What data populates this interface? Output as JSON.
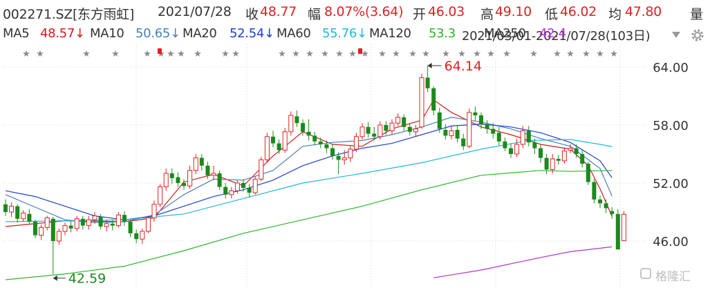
{
  "header": {
    "code": "002271.SZ[东方雨虹]",
    "date": "2021/07/28",
    "close_label": "收",
    "close_value": "48.77",
    "change_label": "幅",
    "change_value": "8.07%(3.64)",
    "open_label": "开",
    "open_value": "46.03",
    "high_label": "高",
    "high_value": "49.10",
    "low_label": "低",
    "low_value": "46.02",
    "avg_label": "均",
    "avg_value": "47.80",
    "vol_label": "量"
  },
  "ma_bar": {
    "ma5_label": "MA5",
    "ma5_value": "48.57↓",
    "ma10_label": "MA10",
    "ma10_value": "50.65↓",
    "ma20_label": "MA20",
    "ma20_value": "52.54↓",
    "ma60_label": "MA60",
    "ma60_value": "55.76↓",
    "ma120_label": "MA120",
    "ma120_value": "53.3",
    "overlap_text": "2021/03/01-2021/07/28(103日)",
    "ma250_label": "MA250",
    "ma250_value": "42.4",
    "dropdown_icon": "triangle-down-icon",
    "settings_icon": "gear-icon"
  },
  "annotations": {
    "max_label": "64.14",
    "min_label": "42.59"
  },
  "watermark": "格隆汇",
  "colors": {
    "up": "#e02020",
    "down": "#1a8a1a",
    "ma5": "#d11b1b",
    "ma10": "#1a3fd0",
    "ma20": "#1a3fd0",
    "ma60": "#22b8e0",
    "ma120": "#2bb52b",
    "ma250": "#b030d0",
    "grid": "#d0d0d0",
    "dark": "#333333"
  },
  "chart_data": {
    "type": "candlestick",
    "title": "002271.SZ[东方雨虹]",
    "period": "2021/03/01-2021/07/28",
    "days": 103,
    "yaxis_ticks": [
      "64.00",
      "58.00",
      "52.00",
      "46.00"
    ],
    "ylim": [
      42,
      67
    ],
    "candles": [
      [
        49.8,
        49.0,
        50.3,
        48.6
      ],
      [
        49.0,
        49.6,
        50.0,
        48.5
      ],
      [
        49.6,
        48.3,
        49.8,
        47.9
      ],
      [
        48.3,
        48.9,
        49.2,
        48.0
      ],
      [
        48.8,
        48.0,
        49.3,
        47.7
      ],
      [
        48.0,
        46.6,
        48.2,
        46.3
      ],
      [
        46.6,
        47.4,
        47.7,
        46.1
      ],
      [
        47.4,
        48.4,
        48.6,
        47.1
      ],
      [
        48.3,
        46.0,
        48.5,
        42.59
      ],
      [
        46.0,
        47.0,
        47.3,
        45.6
      ],
      [
        47.0,
        47.6,
        47.9,
        46.6
      ],
      [
        47.6,
        47.3,
        48.1,
        46.9
      ],
      [
        47.3,
        48.3,
        48.6,
        47.0
      ],
      [
        48.3,
        47.6,
        48.6,
        47.2
      ],
      [
        47.6,
        48.2,
        48.6,
        47.2
      ],
      [
        48.2,
        48.6,
        49.0,
        47.8
      ],
      [
        48.5,
        47.5,
        48.8,
        47.2
      ],
      [
        47.5,
        47.8,
        48.2,
        47.0
      ],
      [
        47.8,
        47.6,
        48.2,
        47.1
      ],
      [
        47.6,
        48.7,
        49.0,
        47.4
      ],
      [
        48.7,
        48.0,
        49.1,
        47.6
      ],
      [
        48.0,
        46.8,
        48.2,
        46.4
      ],
      [
        46.8,
        46.2,
        47.2,
        45.8
      ],
      [
        46.2,
        47.0,
        47.3,
        45.7
      ],
      [
        47.0,
        48.4,
        48.6,
        46.8
      ],
      [
        48.4,
        49.8,
        50.2,
        48.0
      ],
      [
        49.8,
        51.6,
        51.9,
        49.5
      ],
      [
        51.6,
        53.0,
        53.5,
        51.2
      ],
      [
        53.0,
        52.5,
        53.5,
        51.9
      ],
      [
        52.6,
        52.0,
        53.1,
        51.6
      ],
      [
        52.0,
        51.7,
        52.4,
        51.3
      ],
      [
        51.7,
        53.3,
        53.8,
        51.4
      ],
      [
        53.3,
        54.6,
        55.0,
        52.9
      ],
      [
        54.6,
        53.8,
        55.0,
        53.3
      ],
      [
        53.8,
        52.8,
        54.2,
        52.4
      ],
      [
        52.8,
        53.0,
        53.8,
        52.3
      ],
      [
        53.0,
        51.6,
        53.3,
        51.3
      ],
      [
        51.6,
        50.8,
        52.0,
        50.4
      ],
      [
        50.8,
        51.2,
        51.6,
        50.4
      ],
      [
        51.2,
        52.0,
        52.3,
        50.9
      ],
      [
        52.0,
        51.5,
        52.4,
        51.1
      ],
      [
        51.5,
        51.0,
        51.9,
        50.5
      ],
      [
        51.0,
        52.4,
        52.7,
        50.8
      ],
      [
        52.4,
        54.4,
        54.7,
        52.2
      ],
      [
        54.4,
        56.8,
        57.2,
        54.1
      ],
      [
        56.8,
        56.1,
        57.4,
        55.7
      ],
      [
        56.1,
        55.4,
        56.5,
        55.0
      ],
      [
        55.4,
        57.3,
        57.7,
        55.1
      ],
      [
        57.3,
        59.0,
        59.4,
        56.9
      ],
      [
        58.9,
        58.2,
        59.5,
        57.8
      ],
      [
        58.2,
        57.3,
        58.6,
        56.9
      ],
      [
        57.3,
        56.9,
        58.6,
        56.4
      ],
      [
        56.9,
        56.3,
        57.3,
        55.9
      ],
      [
        56.3,
        56.0,
        56.7,
        55.6
      ],
      [
        56.0,
        55.6,
        56.4,
        55.1
      ],
      [
        55.6,
        54.8,
        56.0,
        54.4
      ],
      [
        54.8,
        54.4,
        55.2,
        52.9
      ],
      [
        54.4,
        54.6,
        55.4,
        53.9
      ],
      [
        54.6,
        55.5,
        55.9,
        54.2
      ],
      [
        55.5,
        56.8,
        57.2,
        55.2
      ],
      [
        56.8,
        57.8,
        58.2,
        56.5
      ],
      [
        57.8,
        57.1,
        58.3,
        56.7
      ],
      [
        57.1,
        56.8,
        57.8,
        56.4
      ],
      [
        56.8,
        58.0,
        58.4,
        56.5
      ],
      [
        58.0,
        57.4,
        58.4,
        57.0
      ],
      [
        57.4,
        58.2,
        58.6,
        57.0
      ],
      [
        58.2,
        58.8,
        59.2,
        57.9
      ],
      [
        58.8,
        57.8,
        59.1,
        57.4
      ],
      [
        57.8,
        57.3,
        58.2,
        56.9
      ],
      [
        57.3,
        57.6,
        58.0,
        56.8
      ],
      [
        57.8,
        62.9,
        63.3,
        57.6
      ],
      [
        62.9,
        61.8,
        64.14,
        61.4
      ],
      [
        61.8,
        59.5,
        62.0,
        59.0
      ],
      [
        59.3,
        57.6,
        59.8,
        57.2
      ],
      [
        57.5,
        56.9,
        58.1,
        56.5
      ],
      [
        56.9,
        57.4,
        57.9,
        56.5
      ],
      [
        57.5,
        56.6,
        58.0,
        56.2
      ],
      [
        56.6,
        55.8,
        57.1,
        55.4
      ],
      [
        55.8,
        59.3,
        59.7,
        55.6
      ],
      [
        59.3,
        59.0,
        59.9,
        58.4
      ],
      [
        59.0,
        58.1,
        59.3,
        57.6
      ],
      [
        58.1,
        57.6,
        58.5,
        57.1
      ],
      [
        57.6,
        57.1,
        58.2,
        56.6
      ],
      [
        57.2,
        56.3,
        57.8,
        55.9
      ],
      [
        56.3,
        55.6,
        56.7,
        55.3
      ],
      [
        55.6,
        55.0,
        56.1,
        54.6
      ],
      [
        55.0,
        56.0,
        56.6,
        54.7
      ],
      [
        56.0,
        57.4,
        57.9,
        55.6
      ],
      [
        57.4,
        56.2,
        57.9,
        55.8
      ],
      [
        56.2,
        55.6,
        56.6,
        55.0
      ],
      [
        55.6,
        54.6,
        56.0,
        54.1
      ],
      [
        54.6,
        53.4,
        55.0,
        52.9
      ],
      [
        53.4,
        54.5,
        55.0,
        53.0
      ],
      [
        54.5,
        54.3,
        54.9,
        53.9
      ],
      [
        54.3,
        55.3,
        55.7,
        54.0
      ],
      [
        55.4,
        55.6,
        56.0,
        55.1
      ],
      [
        55.6,
        55.0,
        56.0,
        54.6
      ],
      [
        55.0,
        54.0,
        55.4,
        53.6
      ],
      [
        54.0,
        52.1,
        54.2,
        51.8
      ],
      [
        52.1,
        50.3,
        52.4,
        49.9
      ],
      [
        50.3,
        49.9,
        50.7,
        49.4
      ],
      [
        49.9,
        49.4,
        50.3,
        48.9
      ],
      [
        49.1,
        48.8,
        49.5,
        48.3
      ],
      [
        48.8,
        45.13,
        49.3,
        45.13
      ],
      [
        46.03,
        48.77,
        49.1,
        46.02
      ]
    ],
    "lines": {
      "MA5": [
        [
          0,
          47.5
        ],
        [
          10,
          48.1
        ],
        [
          20,
          48.0
        ],
        [
          25,
          48.4
        ],
        [
          30,
          52.1
        ],
        [
          35,
          52.9
        ],
        [
          40,
          51.7
        ],
        [
          45,
          54.8
        ],
        [
          50,
          57.3
        ],
        [
          55,
          56.0
        ],
        [
          60,
          55.8
        ],
        [
          65,
          57.6
        ],
        [
          70,
          58.5
        ],
        [
          72,
          60.6
        ],
        [
          75,
          59.3
        ],
        [
          80,
          57.8
        ],
        [
          85,
          57.0
        ],
        [
          90,
          56.0
        ],
        [
          95,
          55.5
        ],
        [
          98,
          53.8
        ],
        [
          100,
          51.4
        ],
        [
          102,
          48.57
        ]
      ],
      "MA10": [
        [
          0,
          50.8
        ],
        [
          5,
          49.5
        ],
        [
          10,
          48.2
        ],
        [
          15,
          47.9
        ],
        [
          20,
          48.0
        ],
        [
          25,
          48.7
        ],
        [
          30,
          50.8
        ],
        [
          35,
          52.4
        ],
        [
          40,
          52.3
        ],
        [
          45,
          53.3
        ],
        [
          50,
          55.8
        ],
        [
          55,
          56.2
        ],
        [
          60,
          56.4
        ],
        [
          65,
          57.0
        ],
        [
          70,
          57.8
        ],
        [
          75,
          58.8
        ],
        [
          80,
          58.3
        ],
        [
          85,
          57.6
        ],
        [
          90,
          56.6
        ],
        [
          95,
          55.8
        ],
        [
          100,
          53.5
        ],
        [
          102,
          50.65
        ]
      ],
      "MA20": [
        [
          0,
          51.2
        ],
        [
          5,
          50.6
        ],
        [
          10,
          49.6
        ],
        [
          15,
          48.6
        ],
        [
          20,
          48.2
        ],
        [
          25,
          48.6
        ],
        [
          30,
          49.6
        ],
        [
          35,
          50.6
        ],
        [
          40,
          51.3
        ],
        [
          45,
          52.3
        ],
        [
          50,
          53.8
        ],
        [
          55,
          54.8
        ],
        [
          60,
          55.6
        ],
        [
          65,
          56.1
        ],
        [
          70,
          57.0
        ],
        [
          75,
          57.9
        ],
        [
          80,
          58.1
        ],
        [
          85,
          57.8
        ],
        [
          90,
          57.2
        ],
        [
          95,
          56.2
        ],
        [
          100,
          54.3
        ],
        [
          102,
          52.54
        ]
      ],
      "MA60": [
        [
          0,
          48.0
        ],
        [
          10,
          48.1
        ],
        [
          20,
          48.2
        ],
        [
          30,
          48.8
        ],
        [
          40,
          50.4
        ],
        [
          50,
          52.0
        ],
        [
          60,
          53.0
        ],
        [
          70,
          54.1
        ],
        [
          80,
          55.5
        ],
        [
          88,
          56.4
        ],
        [
          95,
          56.5
        ],
        [
          100,
          56.0
        ],
        [
          102,
          55.76
        ]
      ],
      "MA120": [
        [
          0,
          42.0
        ],
        [
          10,
          42.6
        ],
        [
          20,
          43.4
        ],
        [
          30,
          45.0
        ],
        [
          40,
          46.8
        ],
        [
          50,
          48.2
        ],
        [
          60,
          49.6
        ],
        [
          70,
          51.3
        ],
        [
          80,
          52.8
        ],
        [
          90,
          53.3
        ],
        [
          95,
          53.2
        ],
        [
          102,
          53.3
        ]
      ],
      "MA250": [
        [
          72,
          42.2
        ],
        [
          80,
          43.0
        ],
        [
          90,
          44.3
        ],
        [
          95,
          44.9
        ],
        [
          102,
          45.4
        ]
      ]
    },
    "stars_row": true
  }
}
